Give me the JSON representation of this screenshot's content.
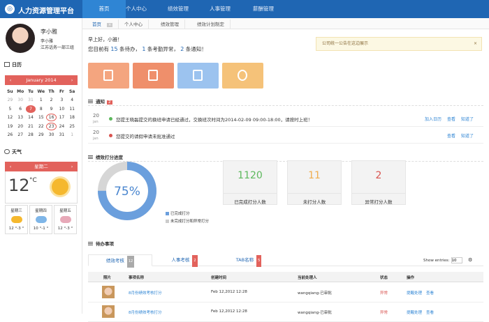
{
  "app": {
    "title": "人力资源管理平台",
    "logo_icon": "globe-icon"
  },
  "nav": [
    "首页",
    "个人中心",
    "绩效管理",
    "人事管理",
    "薪酬管理"
  ],
  "user": {
    "name": "李小雅",
    "role": "李小雅",
    "org": "江苏话务一部三组"
  },
  "calendar": {
    "section_label": "日历",
    "month": "January 2014",
    "prev": "‹",
    "next": "›",
    "weekdays": [
      "Su",
      "Mo",
      "Tu",
      "We",
      "Th",
      "Fr",
      "Sa"
    ],
    "weeks": [
      [
        "29",
        "30",
        "31",
        "1",
        "2",
        "3",
        "4"
      ],
      [
        "5",
        "6",
        "7",
        "8",
        "9",
        "10",
        "11"
      ],
      [
        "12",
        "13",
        "14",
        "15",
        "16",
        "17",
        "18"
      ],
      [
        "19",
        "20",
        "21",
        "22",
        "23",
        "24",
        "25"
      ],
      [
        "26",
        "27",
        "28",
        "29",
        "30",
        "31",
        "1"
      ]
    ],
    "today": "7",
    "circled": [
      "16",
      "23"
    ]
  },
  "weather": {
    "section_label": "天气",
    "day": "星期二",
    "temp": "12",
    "unit": "°C",
    "forecast": [
      {
        "day": "星期三",
        "range": "12 °-3 °",
        "icon": "sun-cloud-icon"
      },
      {
        "day": "星期四",
        "range": "10 °-1 °",
        "icon": "cloud-icon"
      },
      {
        "day": "星期五",
        "range": "12 °-3 °",
        "icon": "rain-cloud-icon"
      }
    ]
  },
  "tabs": [
    {
      "label": "首页",
      "badge": "×"
    },
    {
      "label": "个人中心"
    },
    {
      "label": "绩效管理"
    },
    {
      "label": "绩效计划制定"
    }
  ],
  "greeting": {
    "line1": "早上好，小雅！",
    "pre": "您目前有",
    "pending": "15",
    "pending_label": "条待办，",
    "abnormal": "1",
    "abnormal_label": "条考勤异常，",
    "notices": "2",
    "notices_label": "条通知！"
  },
  "announcement": {
    "text": "公司统一公告在这边展示",
    "close": "×"
  },
  "tile_colors": [
    "#f4a57f",
    "#ef8f6b",
    "#9cc3ef",
    "#f5c279"
  ],
  "notify": {
    "title": "通知",
    "count": "2",
    "items": [
      {
        "day": "20",
        "mon": "jan",
        "text": "您提王晓磊提交的换班申请已经通过，交换班次时间为2014-02-09 09:00-18:00，请按时上班！",
        "dot": "#5cb85c",
        "actions": [
          "加入日历",
          "查看",
          "知道了"
        ]
      },
      {
        "day": "20",
        "mon": "jan",
        "text": "您提交的请假申请未批准通过",
        "dot": "#d9534f",
        "actions": [
          "查看",
          "知道了"
        ]
      }
    ]
  },
  "progress": {
    "title": "绩效打分进度",
    "percent_label": "75%",
    "percent": 75,
    "legend": [
      "已完成打分",
      "未完成打分和异常打分"
    ],
    "legend_colors": [
      "#6b9fdd",
      "#cccccc"
    ],
    "stats": [
      {
        "value": "1120",
        "label": "已完成打分人数",
        "color": "#5cb85c"
      },
      {
        "value": "11",
        "label": "未打分人数",
        "color": "#f0ad4e"
      },
      {
        "value": "2",
        "label": "异常打分人数",
        "color": "#d9534f"
      }
    ]
  },
  "todo": {
    "title": "待办事项",
    "tabs": [
      {
        "label": "绩效考核",
        "count": "12",
        "count_color": "#aaaaaa"
      },
      {
        "label": "人事考核",
        "count": "2",
        "count_color": "#e2625c"
      },
      {
        "label": "TAB名称",
        "count": "5",
        "count_color": "#e2625c"
      }
    ],
    "show_entries_label": "Show entries:",
    "show_entries_value": "10",
    "columns": [
      "照片",
      "事项名称",
      "创建时间",
      "当前处理人",
      "状态",
      "操作"
    ],
    "rows": [
      {
        "name": "8月份绩效考核打分",
        "created": "Feb 12,2012 12:28",
        "handler": "wangqiang-已审批",
        "status": "异常",
        "actions": [
          "提醒处理",
          "查看"
        ]
      },
      {
        "name": "8月份绩效考核打分",
        "created": "Feb 12,2012 12:28",
        "handler": "wangqiang-已审批",
        "status": "异常",
        "actions": [
          "提醒处理",
          "查看"
        ]
      }
    ]
  }
}
